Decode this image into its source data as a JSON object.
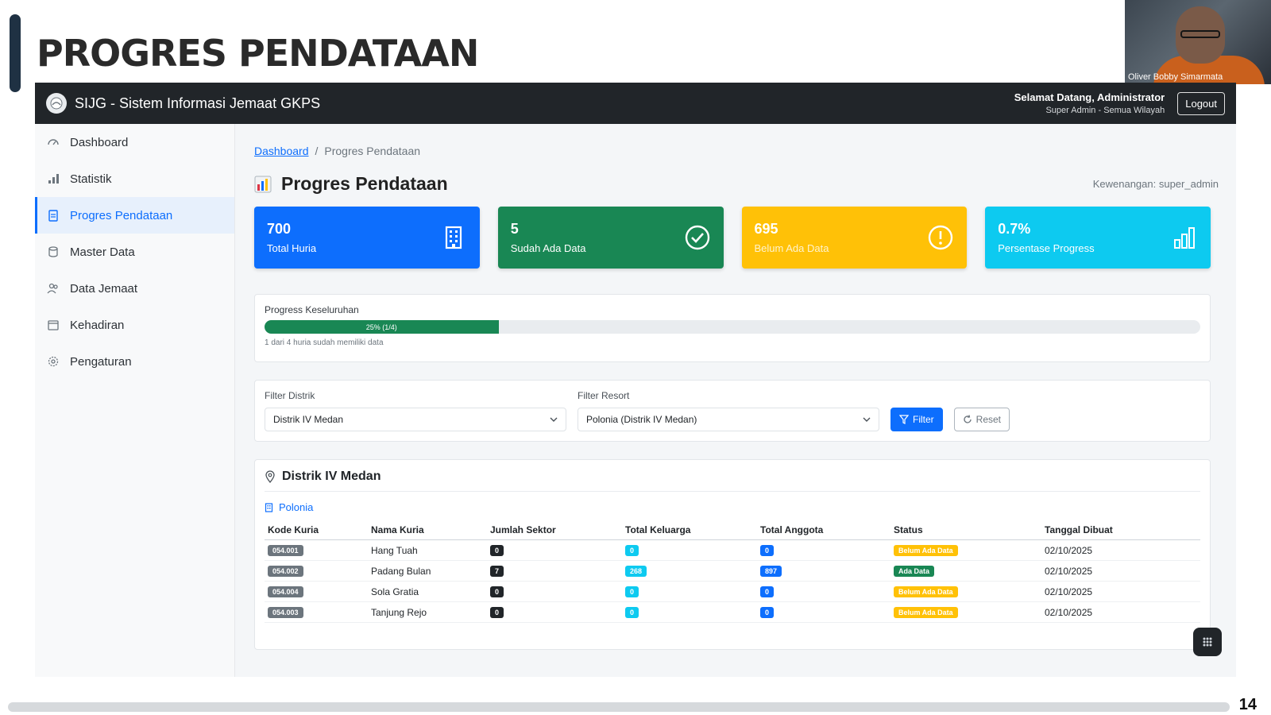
{
  "slide": {
    "title": "PROGRES PENDATAAN",
    "page_number": "14"
  },
  "video": {
    "participant_name": "Oliver Bobby Simarmata"
  },
  "app": {
    "brand": "SIJG - Sistem Informasi Jemaat GKPS",
    "welcome_title": "Selamat Datang, Administrator",
    "welcome_sub": "Super Admin - Semua Wilayah",
    "logout_label": "Logout"
  },
  "sidebar": {
    "items": [
      {
        "label": "Dashboard",
        "icon": "gauge-icon"
      },
      {
        "label": "Statistik",
        "icon": "bar-chart-icon"
      },
      {
        "label": "Progres Pendataan",
        "icon": "clipboard-icon",
        "active": true
      },
      {
        "label": "Master Data",
        "icon": "database-icon"
      },
      {
        "label": "Data Jemaat",
        "icon": "people-icon"
      },
      {
        "label": "Kehadiran",
        "icon": "calendar-icon"
      },
      {
        "label": "Pengaturan",
        "icon": "gear-icon"
      }
    ]
  },
  "breadcrumb": {
    "home": "Dashboard",
    "separator": "/",
    "current": "Progres Pendataan"
  },
  "page": {
    "title": "Progres Pendataan",
    "role": "Kewenangan: super_admin"
  },
  "stats": [
    {
      "value": "700",
      "label": "Total Huria",
      "color": "#0d6efd",
      "icon": "building-icon"
    },
    {
      "value": "5",
      "label": "Sudah Ada Data",
      "color": "#198754",
      "icon": "check-circle-icon"
    },
    {
      "value": "695",
      "label": "Belum Ada Data",
      "color": "#ffc107",
      "icon": "exclamation-circle-icon"
    },
    {
      "value": "0.7%",
      "label": "Persentase Progress",
      "color": "#0dcaf0",
      "icon": "bar-chart-icon"
    }
  ],
  "progress": {
    "title": "Progress Keseluruhan",
    "fill_percent": 25,
    "bar_text": "25% (1/4)",
    "note": "1 dari 4 huria sudah memiliki data"
  },
  "filters": {
    "distrik_label": "Filter Distrik",
    "distrik_value": "Distrik IV Medan",
    "resort_label": "Filter Resort",
    "resort_value": "Polonia (Distrik IV Medan)",
    "filter_button": "Filter",
    "reset_button": "Reset"
  },
  "table": {
    "district": "Distrik IV Medan",
    "resort": "Polonia",
    "columns": [
      "Kode Kuria",
      "Nama Kuria",
      "Jumlah Sektor",
      "Total Keluarga",
      "Total Anggota",
      "Status",
      "Tanggal Dibuat"
    ],
    "rows": [
      {
        "code": "054.001",
        "name": "Hang Tuah",
        "sektor": "0",
        "keluarga": "0",
        "anggota": "0",
        "status": "Belum Ada Data",
        "status_type": "warn",
        "date": "02/10/2025"
      },
      {
        "code": "054.002",
        "name": "Padang Bulan",
        "sektor": "7",
        "keluarga": "268",
        "anggota": "897",
        "status": "Ada Data",
        "status_type": "ok",
        "date": "02/10/2025"
      },
      {
        "code": "054.004",
        "name": "Sola Gratia",
        "sektor": "0",
        "keluarga": "0",
        "anggota": "0",
        "status": "Belum Ada Data",
        "status_type": "warn",
        "date": "02/10/2025"
      },
      {
        "code": "054.003",
        "name": "Tanjung Rejo",
        "sektor": "0",
        "keluarga": "0",
        "anggota": "0",
        "status": "Belum Ada Data",
        "status_type": "warn",
        "date": "02/10/2025"
      }
    ]
  }
}
